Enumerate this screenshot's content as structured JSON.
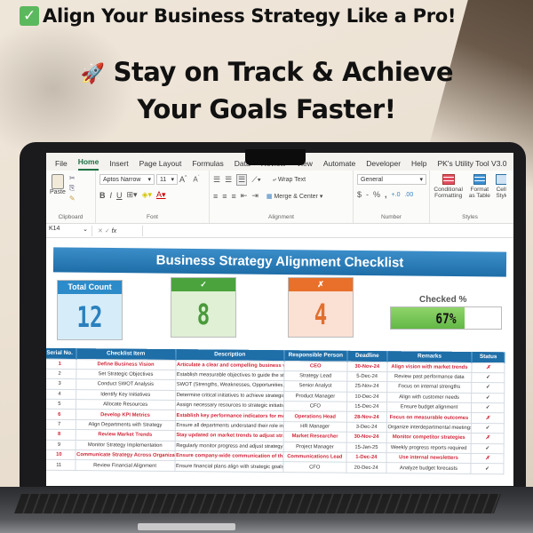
{
  "headline": {
    "line1": "Align Your Business Strategy Like a Pro!",
    "line1_icon": "check-mark-emoji",
    "line2": "Stay on Track & Achieve",
    "line2_icon": "rocket-emoji",
    "line3": "Your Goals Faster!"
  },
  "excel": {
    "tabs": [
      "File",
      "Home",
      "Insert",
      "Page Layout",
      "Formulas",
      "Data",
      "Review",
      "View",
      "Automate",
      "Developer",
      "Help",
      "PK's Utility Tool V3.0"
    ],
    "active_tab": "Home",
    "ribbon": {
      "clipboard": {
        "paste": "Paste",
        "label": "Clipboard"
      },
      "font": {
        "name": "Aptos Narrow",
        "size": "11",
        "label": "Font",
        "bold": "B",
        "italic": "I",
        "underline": "U"
      },
      "alignment": {
        "wrap_text": "Wrap Text",
        "merge_center": "Merge & Center",
        "label": "Alignment"
      },
      "number": {
        "format": "General",
        "currency": "$",
        "percent": "%",
        "comma": ",",
        "label": "Number"
      },
      "styles": {
        "conditional_formatting": "Conditional Formatting",
        "format_as_table": "Format as Table",
        "cell_styles": "Cell Styles",
        "label": "Styles"
      }
    },
    "formula_bar": {
      "cell_ref": "K14",
      "fx": "fx",
      "value": ""
    }
  },
  "sheet": {
    "title": "Business Strategy Alignment Checklist",
    "cards": {
      "total": {
        "label": "Total Count",
        "value": "12"
      },
      "checked": {
        "label": "✓",
        "value": "8"
      },
      "unchecked": {
        "label": "✗",
        "value": "4"
      }
    },
    "checked_pct": {
      "label": "Checked %",
      "value": "67%",
      "fraction": 0.67
    },
    "table": {
      "columns": [
        "Serial No.",
        "Checklist Item",
        "Description",
        "Responsible Person",
        "Deadline",
        "Remarks",
        "Status"
      ],
      "rows": [
        {
          "no": "1",
          "item": "Define Business Vision",
          "desc": "Articulate a clear and compelling business vision",
          "person": "CEO",
          "deadline": "30-Nov-24",
          "remarks": "Align vision with market trends",
          "status": "✗",
          "highlight": true
        },
        {
          "no": "2",
          "item": "Set Strategic Objectives",
          "desc": "Establish measurable objectives to guide the strategy",
          "person": "Strategy Lead",
          "deadline": "5-Dec-24",
          "remarks": "Review past performance data",
          "status": "✓",
          "highlight": false
        },
        {
          "no": "3",
          "item": "Conduct SWOT Analysis",
          "desc": "SWOT (Strengths, Weaknesses, Opportunities, Threats)",
          "person": "Senior Analyst",
          "deadline": "25-Nov-24",
          "remarks": "Focus on internal strengths",
          "status": "✓",
          "highlight": false
        },
        {
          "no": "4",
          "item": "Identify Key Initiatives",
          "desc": "Determine critical initiatives to achieve strategic goals",
          "person": "Product Manager",
          "deadline": "10-Dec-24",
          "remarks": "Align with customer needs",
          "status": "✓",
          "highlight": false
        },
        {
          "no": "5",
          "item": "Allocate Resources",
          "desc": "Assign necessary resources to strategic initiatives",
          "person": "CFO",
          "deadline": "15-Dec-24",
          "remarks": "Ensure budget alignment",
          "status": "✓",
          "highlight": false
        },
        {
          "no": "6",
          "item": "Develop KPI Metrics",
          "desc": "Establish key performance indicators for measuring success",
          "person": "Operations Head",
          "deadline": "28-Nov-24",
          "remarks": "Focus on measurable outcomes",
          "status": "✗",
          "highlight": true
        },
        {
          "no": "7",
          "item": "Align Departments with Strategy",
          "desc": "Ensure all departments understand their role in strategy",
          "person": "HR Manager",
          "deadline": "3-Dec-24",
          "remarks": "Organize interdepartmental meetings",
          "status": "✓",
          "highlight": false
        },
        {
          "no": "8",
          "item": "Review Market Trends",
          "desc": "Stay updated on market trends to adjust strategy if needed",
          "person": "Market Researcher",
          "deadline": "30-Nov-24",
          "remarks": "Monitor competitor strategies",
          "status": "✗",
          "highlight": true
        },
        {
          "no": "9",
          "item": "Monitor Strategy Implementation",
          "desc": "Regularly monitor progress and adjust strategy accordingly",
          "person": "Project Manager",
          "deadline": "15-Jan-25",
          "remarks": "Weekly progress reports required",
          "status": "✓",
          "highlight": false
        },
        {
          "no": "10",
          "item": "Communicate Strategy Across Organization",
          "desc": "Ensure company-wide communication of the strategy",
          "person": "Communications Lead",
          "deadline": "1-Dec-24",
          "remarks": "Use internal newsletters",
          "status": "✗",
          "highlight": true
        },
        {
          "no": "11",
          "item": "Review Financial Alignment",
          "desc": "Ensure financial plans align with strategic goals",
          "person": "CFO",
          "deadline": "20-Dec-24",
          "remarks": "Analyze budget forecasts",
          "status": "✓",
          "highlight": false
        }
      ]
    }
  },
  "colors": {
    "header_blue": "#1e6ea8",
    "checked_green": "#4aa33d",
    "unchecked_orange": "#e8702a",
    "highlight_red": "#d0283a"
  }
}
